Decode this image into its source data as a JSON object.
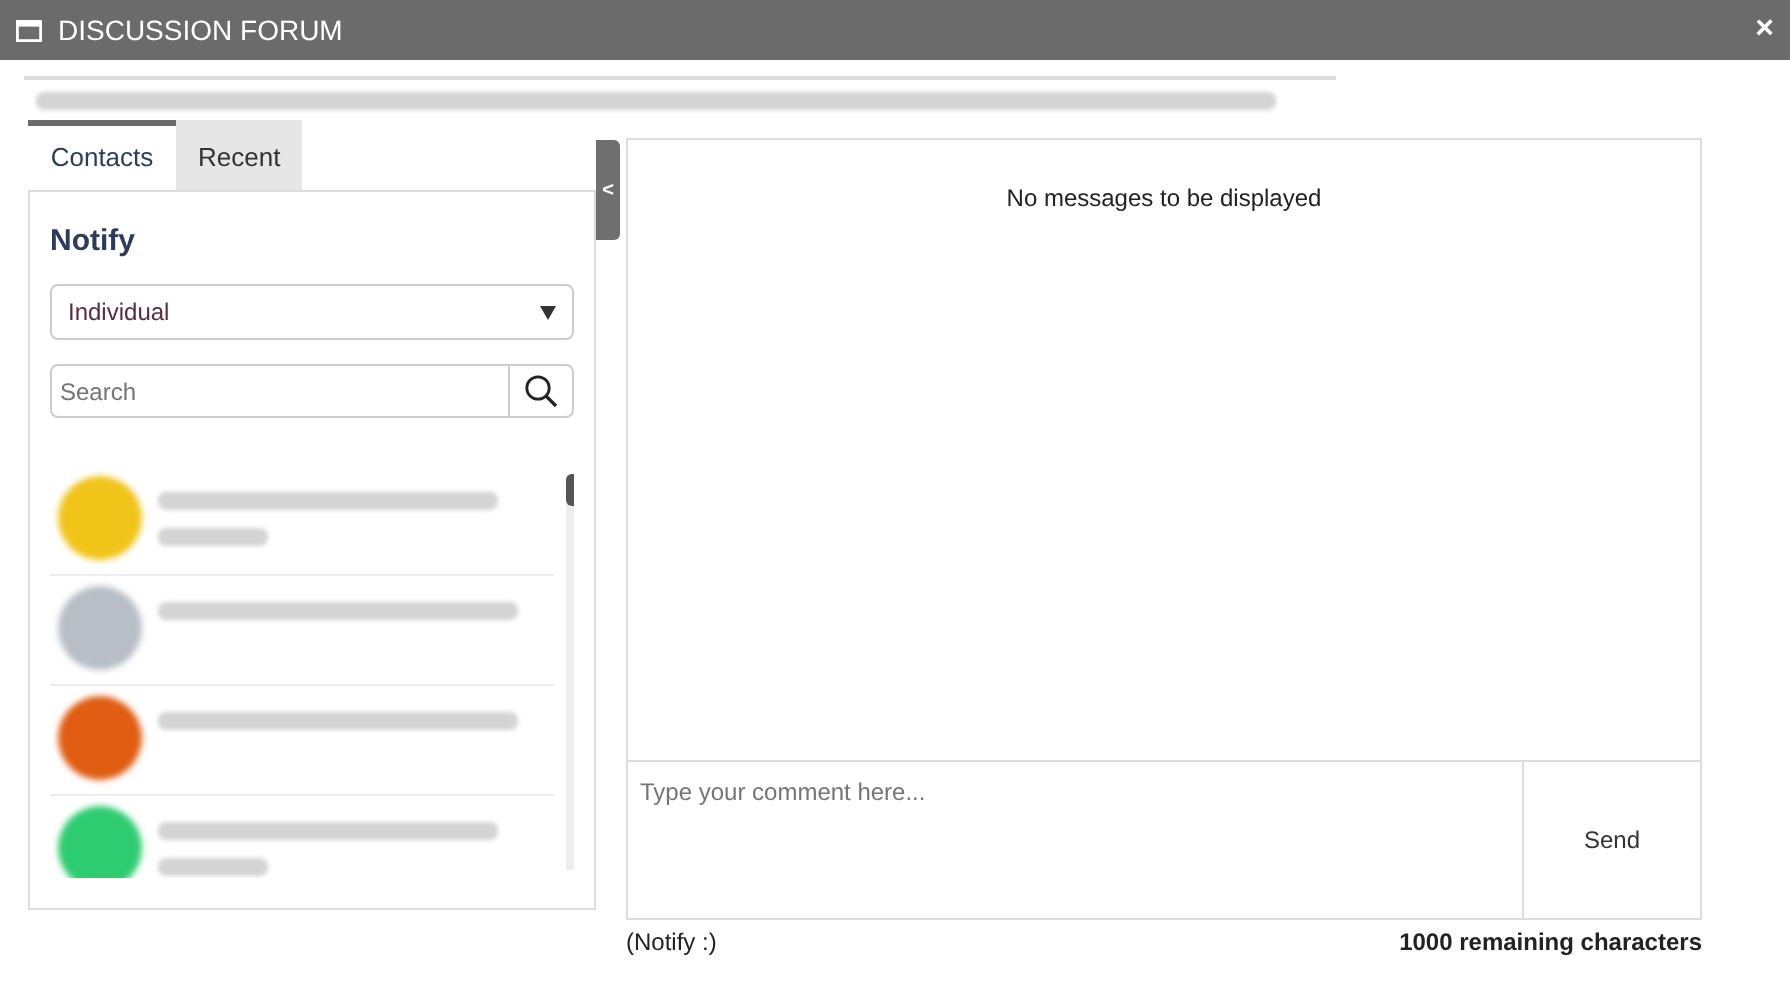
{
  "window": {
    "title": "DISCUSSION FORUM",
    "close": "×"
  },
  "project": {
    "kind": "redacted"
  },
  "tabs": [
    {
      "label": "Contacts",
      "selected": true
    },
    {
      "label": "Recent",
      "selected": false
    }
  ],
  "notify": {
    "heading": "Notify",
    "select_value": "Individual",
    "search_placeholder": "Search"
  },
  "contacts": [
    {
      "kind": "two_line",
      "color": "#f0c419"
    },
    {
      "kind": "one_line",
      "color": "#b8bec6"
    },
    {
      "kind": "one_line",
      "color": "#e05d12"
    },
    {
      "kind": "two_line",
      "color": "#2ecc71"
    }
  ],
  "toggle": "<",
  "messages": {
    "empty": "No messages to be displayed"
  },
  "comment": {
    "placeholder": "Type your comment here...",
    "send": "Send"
  },
  "footer": {
    "notify": "(Notify :)",
    "remaining": "1000 remaining characters"
  }
}
